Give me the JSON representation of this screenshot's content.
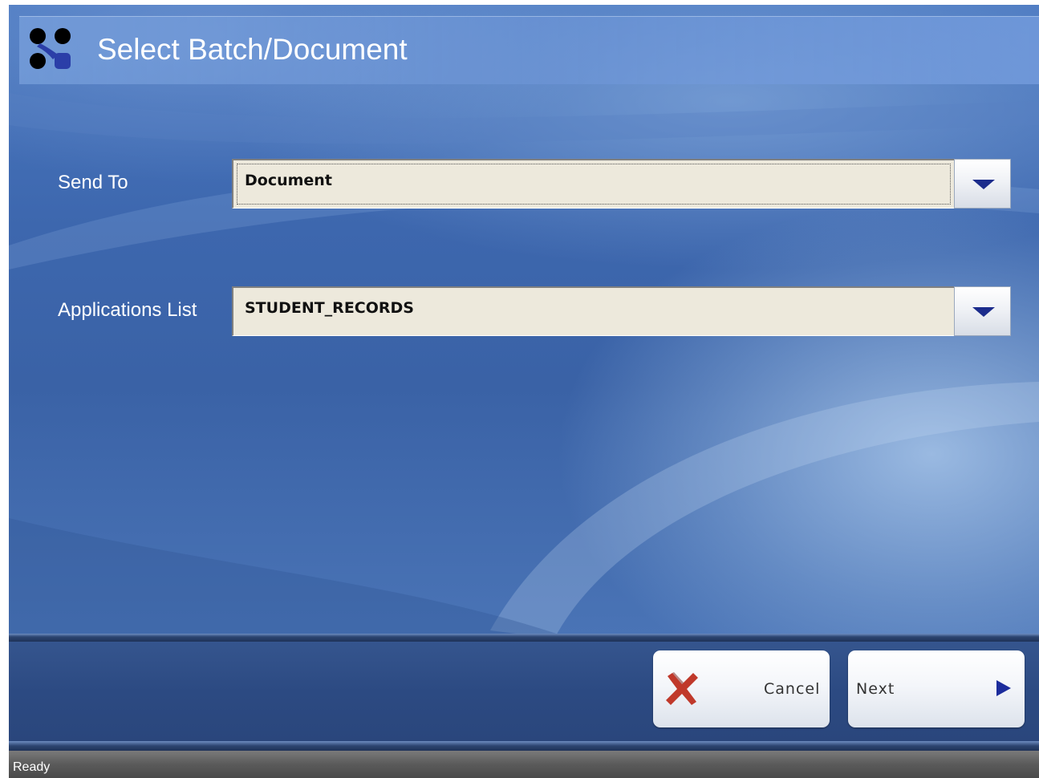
{
  "header": {
    "title": "Select Batch/Document",
    "logo_icon": "four-dots-logo-icon"
  },
  "form": {
    "send_to": {
      "label": "Send To",
      "value": "Document",
      "dropdown_icon": "chevron-down-icon"
    },
    "applications_list": {
      "label": "Applications List",
      "value": "STUDENT_RECORDS",
      "dropdown_icon": "chevron-down-icon"
    }
  },
  "footer": {
    "cancel_label": "Cancel",
    "cancel_icon": "close-x-icon",
    "next_label": "Next",
    "next_icon": "play-arrow-icon"
  },
  "status": {
    "text": "Ready"
  },
  "colors": {
    "background": "#3e66a8",
    "field_bg": "#ede9dc",
    "dropdown_arrow": "#1c2c8c",
    "cancel_x": "#c0392b",
    "next_arrow": "#1c2c9c",
    "status_bar": "#5a5a5a"
  }
}
